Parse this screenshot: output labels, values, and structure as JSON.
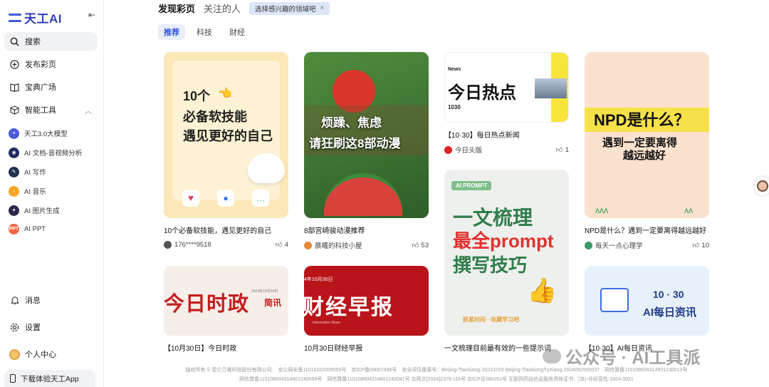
{
  "app": {
    "logo_text": "天工AI"
  },
  "sidebar": {
    "collapse_icon": "collapse-left-icon",
    "nav": [
      {
        "label": "搜索",
        "icon": "search-icon"
      },
      {
        "label": "发布彩页",
        "icon": "plus-circle-icon"
      },
      {
        "label": "宝典广场",
        "icon": "book-icon"
      },
      {
        "label": "智能工具",
        "icon": "cube-icon"
      }
    ],
    "tools": [
      {
        "label": "天工3.0大模型",
        "color": "#4a5ad8"
      },
      {
        "label": "AI 文档-音视频分析",
        "color": "#1e2a5c"
      },
      {
        "label": "AI 写作",
        "color": "#22314d"
      },
      {
        "label": "AI 音乐",
        "color": "#f5a623"
      },
      {
        "label": "AI 图片生成",
        "color": "#2b2b48"
      },
      {
        "label": "AI PPT",
        "color": "#f0643c",
        "badge": "PPT"
      }
    ],
    "bottom": [
      {
        "label": "消息",
        "icon": "bell-icon"
      },
      {
        "label": "设置",
        "icon": "gear-icon"
      },
      {
        "label": "个人中心",
        "icon": "avatar-icon"
      }
    ],
    "download_label": "下载体验天工App"
  },
  "header": {
    "tab_discover": "发现彩页",
    "tab_following": "关注的人",
    "hint": "选择感兴趣的领域吧",
    "hint_close": "×"
  },
  "categories": [
    "推荐",
    "科技",
    "财经"
  ],
  "cards": [
    {
      "title": "10个必备软技能，遇见更好的自己",
      "author": "176****9518",
      "likes": "4",
      "img_line1": "10个",
      "img_line2": "必备软技能",
      "img_line3": "遇见更好的自己"
    },
    {
      "title": "8部宫崎骏动漫推荐",
      "author": "晨曦的科技小屋",
      "likes": "53",
      "img_line1": "烦躁、焦虑",
      "img_line2": "请狂刷这8部动漫"
    },
    {
      "title": "【10·30】每日热点新闻",
      "author": "今日头版",
      "likes": "1",
      "img_tag": "News",
      "img_line1": "今日热点",
      "img_date": "1030"
    },
    {
      "title": "NPD是什么？遇到一定要离得越远越好",
      "author": "每天一点心理学",
      "likes": "10",
      "img_line1": "NPD是什么？",
      "img_line2": "遇到一定要离得",
      "img_line3": "越远越好"
    },
    {
      "title": "【10月30日】今日时政",
      "img_line1": "今日时政",
      "img_small": "2024年10月30日",
      "img_tag": "简讯"
    },
    {
      "title": "10月30日财经早报",
      "img_line1": "财经早报",
      "img_small": "4年10月30日",
      "img_tag": "Information News"
    },
    {
      "title": "一文梳理目前最有效的一些提示词",
      "img_tag": "AI PROMPT",
      "img_line1": "一文梳理",
      "img_line2": "最全prompt",
      "img_line3": "撰写技巧",
      "img_small": "抓紧时间 · 收藏学习吧"
    },
    {
      "title": "【10·30】AI每日资讯",
      "img_line1": "10 · 30",
      "img_line2": "AI每日资讯"
    }
  ],
  "footer": {
    "line1": "版权所有 © 昆仑万维科技股份有限公司 　京公网安备11010102006563号　京ICP备09007496号　安全评估备案号：Beijing-TianGong-20231016 Beijing-TianGongTuXiang-2024092500037　网信算备110108604314601230013号",
    "line2": "网信算备110108604314601240059号　网信算备110108604314601240041号 京网文[2024]2379-116号 京ICP证080262号 互联网药品信息服务资格证书：(京)-非经营性-2024-0021"
  },
  "watermark": "公众号 · AI工具派"
}
